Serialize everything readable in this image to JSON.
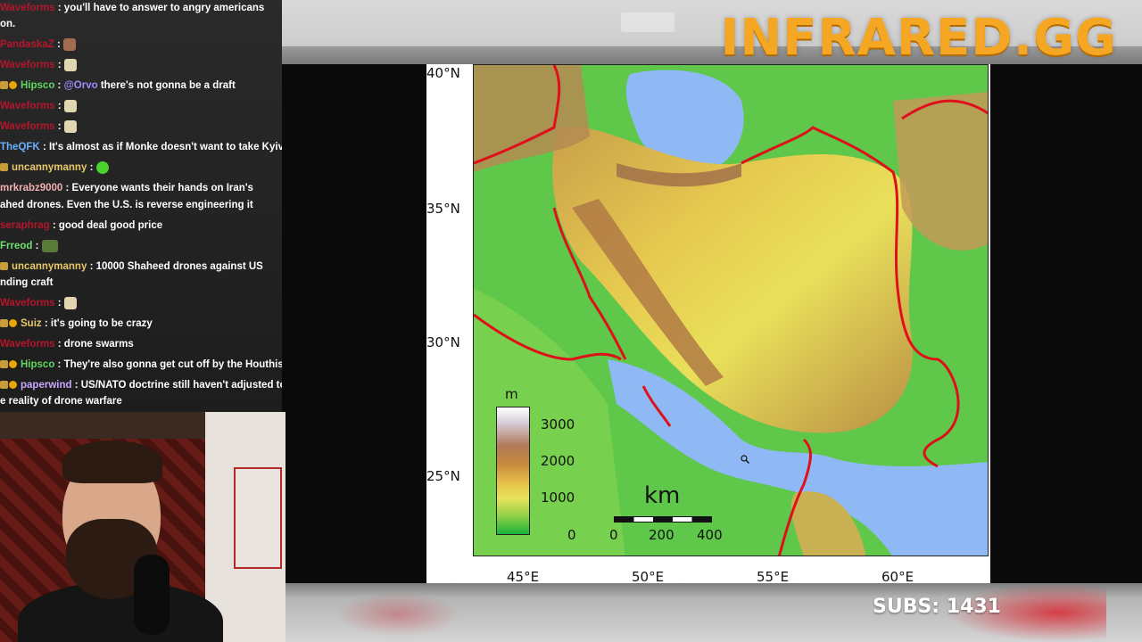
{
  "overlay": {
    "brand": "INFRARED.GG",
    "subs": "SUBS: 1431"
  },
  "chat": [
    {
      "user": "Waveforms",
      "color": "#b5162b",
      "text": ": you'll have to answer to angry americans",
      "badges": []
    },
    {
      "user": "",
      "color": "#ffffff",
      "text": "on.",
      "badges": []
    },
    {
      "user": "PandaskaZ",
      "color": "#b5162b",
      "text": ":",
      "badges": [],
      "emote": "face"
    },
    {
      "user": "Waveforms",
      "color": "#b5162b",
      "text": ":",
      "badges": [],
      "emote": "ghost"
    },
    {
      "user": "Hipsco",
      "color": "#5fd55f",
      "text": "there's not gonna be a draft",
      "mention": "@Orvo",
      "badges": [
        "crown",
        "gold"
      ]
    },
    {
      "user": "Waveforms",
      "color": "#b5162b",
      "text": ":",
      "badges": [],
      "emote": "ghost"
    },
    {
      "user": "Waveforms",
      "color": "#b5162b",
      "text": ":",
      "badges": [],
      "emote": "ghost"
    },
    {
      "user": "TheQFK",
      "color": "#6ab0ff",
      "text": ": It's almost as if Monke doesn't want to take Kyiv",
      "badges": []
    },
    {
      "user": "uncannymanny",
      "color": "#e8c86a",
      "text": ":",
      "badges": [
        "crown"
      ],
      "emote": "green"
    },
    {
      "user": "mrkrabz9000",
      "color": "#f0b0b0",
      "text": ": Everyone wants their hands on Iran's",
      "badges": []
    },
    {
      "user": "",
      "color": "#ffffff",
      "text": "ahed drones. Even the U.S. is reverse engineering it",
      "badges": []
    },
    {
      "user": "seraphrag",
      "color": "#b5162b",
      "text": ": good deal good price",
      "badges": []
    },
    {
      "user": "Frreod",
      "color": "#6ee06e",
      "text": ":",
      "badges": [],
      "emote": "veh"
    },
    {
      "user": "uncannymanny",
      "color": "#e8c86a",
      "text": ": 10000 Shaheed drones against US",
      "badges": [
        "crown"
      ]
    },
    {
      "user": "",
      "color": "#ffffff",
      "text": "nding craft",
      "badges": []
    },
    {
      "user": "Waveforms",
      "color": "#b5162b",
      "text": ":",
      "badges": [],
      "emote": "ghost"
    },
    {
      "user": "Suiz",
      "color": "#e8c86a",
      "text": ": it's going to be crazy",
      "badges": [
        "crown",
        "gold"
      ]
    },
    {
      "user": "Waveforms",
      "color": "#b5162b",
      "text": ": drone swarms",
      "badges": []
    },
    {
      "user": "Hipsco",
      "color": "#5fd55f",
      "text": ": They're also gonna get cut off by the Houthis",
      "badges": [
        "crown",
        "gold"
      ]
    },
    {
      "user": "paperwind",
      "color": "#c9a8ff",
      "text": ": US/NATO doctrine still haven't adjusted to",
      "badges": [
        "crown",
        "gold"
      ]
    },
    {
      "user": "",
      "color": "#ffffff",
      "text": "e reality of drone warfare",
      "badges": []
    }
  ],
  "map": {
    "lat_labels": [
      "40°N",
      "35°N",
      "30°N",
      "25°N"
    ],
    "lon_labels": [
      "45°E",
      "50°E",
      "55°E",
      "60°E"
    ],
    "legend_unit": "m",
    "legend_ticks": [
      "3000",
      "2000",
      "1000",
      "0"
    ],
    "scale_unit": "km",
    "scale_ticks": [
      "0",
      "200",
      "400"
    ]
  },
  "colors": {
    "brand": "#f5a623",
    "sea": "#8fb9f5",
    "border": "#e0101a"
  }
}
